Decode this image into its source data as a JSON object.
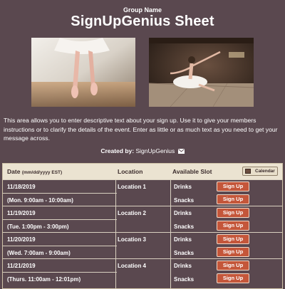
{
  "header": {
    "group_name": "Group Name",
    "title": "SignUpGenius Sheet"
  },
  "description": "This area allows you to enter descriptive text about your sign up. Use it to give your members instructions or to clarify the details of the event. Enter as little or as much text as you need to get your message across.",
  "created_by": {
    "label": "Created by:",
    "name": "SignUpGenius"
  },
  "table": {
    "col_date": "Date",
    "col_date_format": "(mm/dd/yyyy EST)",
    "col_location": "Location",
    "col_slot": "Available Slot",
    "calendar_label": "Calendar",
    "signup_label": "Sign Up",
    "rows": [
      {
        "date": "11/18/2019",
        "time": "(Mon. 9:00am - 10:00am)",
        "location": "Location 1",
        "slots": [
          "Drinks",
          "Snacks"
        ]
      },
      {
        "date": "11/19/2019",
        "time": "(Tue. 1:00pm - 3:00pm)",
        "location": "Location 2",
        "slots": [
          "Drinks",
          "Snacks"
        ]
      },
      {
        "date": "11/20/2019",
        "time": "(Wed. 7:00am - 9:00am)",
        "location": "Location 3",
        "slots": [
          "Drinks",
          "Snacks"
        ]
      },
      {
        "date": "11/21/2019",
        "time": "(Thurs. 11:00am - 12:01pm)",
        "location": "Location 4",
        "slots": [
          "Drinks",
          "Snacks"
        ]
      }
    ]
  },
  "colors": {
    "background": "#5a484f",
    "header_row": "#ebe3d1",
    "signup_button": "#c4563a"
  },
  "icons": [
    "mail-icon",
    "calendar-icon"
  ]
}
